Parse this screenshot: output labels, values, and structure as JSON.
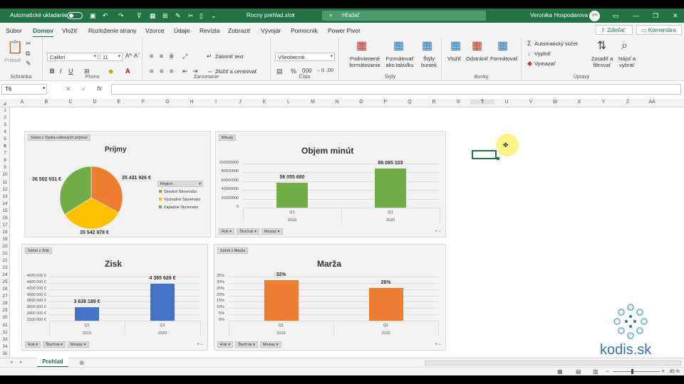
{
  "titlebar": {
    "autosave_label": "Automatické ukladanie",
    "filename": "Rocny prehlad.xlsx",
    "search_placeholder": "Hľadať",
    "user_name": "Veronika Hospodarova",
    "user_initials": "VH"
  },
  "tabs": [
    "Súbor",
    "Domov",
    "Vložiť",
    "Rozloženie strany",
    "Vzorce",
    "Údaje",
    "Revízia",
    "Zobraziť",
    "Vývojár",
    "Pomocník",
    "Power Pivot"
  ],
  "active_tab": "Domov",
  "share_label": "Zdieľať",
  "comments_label": "Komentáre",
  "ribbon": {
    "clipboard": {
      "paste": "Prilepiť",
      "group": "Schránka"
    },
    "font": {
      "name": "Calibri",
      "size": "11",
      "group": "Písmo"
    },
    "alignment": {
      "wrap": "Zalomiť text",
      "merge": "Zlúčiť a centrovať",
      "group": "Zarovnanie"
    },
    "number": {
      "format": "Všeobecné",
      "group": "Číslo"
    },
    "styles": {
      "conditional": [
        "Podmienené",
        "formátovanie"
      ],
      "table": [
        "Formátovať",
        "ako tabuľku"
      ],
      "cell": [
        "Štýly",
        "buniek"
      ],
      "group": "Štýly"
    },
    "cells": {
      "insert": "Vložiť",
      "delete": "Odstrániť",
      "format": "Formátovať",
      "group": "Bunky"
    },
    "editing": {
      "autosum": "Automatický súčet",
      "fill": "Vyplniť",
      "clear": "Vymazať",
      "sort": [
        "Zoradiť a",
        "filtrovať"
      ],
      "find": [
        "Nájsť a",
        "vybrať"
      ],
      "group": "Úpravy"
    }
  },
  "formula_bar": {
    "name_box": "T6",
    "fx": "fx",
    "formula": ""
  },
  "columns": [
    "A",
    "B",
    "C",
    "D",
    "E",
    "F",
    "G",
    "H",
    "I",
    "J",
    "K",
    "L",
    "M",
    "N",
    "O",
    "P",
    "Q",
    "R",
    "S",
    "T",
    "U",
    "V",
    "W",
    "X",
    "Y",
    "Z",
    "AA"
  ],
  "selected_column": "T",
  "rows": [
    "1",
    "2",
    "3",
    "4",
    "5",
    "6",
    "7",
    "8",
    "9",
    "10",
    "11",
    "12",
    "13",
    "14",
    "15",
    "16",
    "17",
    "18",
    "19",
    "20",
    "21",
    "22",
    "23",
    "24",
    "25",
    "26",
    "27",
    "28",
    "29",
    "30",
    "31",
    "32",
    "33",
    "34",
    "35"
  ],
  "selected_row": "6",
  "sheet_tab": "Prehlad",
  "zoom": "85 %",
  "brand": "kodis.sk",
  "chart_data": [
    {
      "type": "pie",
      "label": "Súčet z Vyska celkových príjmov",
      "title": "Príjmy",
      "legend_title": "Region",
      "slices": [
        {
          "name": "Stredné Slovensko",
          "value_label": "35 431 926 €",
          "value": 35431926,
          "color": "#ed7d31"
        },
        {
          "name": "Východné Slovensko",
          "value_label": "35 542 978 €",
          "value": 35542978,
          "color": "#ffc000"
        },
        {
          "name": "Západné Slovensko",
          "value_label": "36 502 031 €",
          "value": 36502031,
          "color": "#70ad47"
        }
      ]
    },
    {
      "type": "bar",
      "label": "Minuty",
      "title": "Objem minút",
      "color": "#70ad47",
      "yticks": [
        "100000000",
        "80000000",
        "60000000",
        "40000000",
        "20000000",
        "0"
      ],
      "ylim": [
        0,
        100000000
      ],
      "categories": [
        {
          "q": "Q1",
          "year": "2019"
        },
        {
          "q": "Q1",
          "year": "2020"
        }
      ],
      "values": [
        56055680,
        88085103
      ],
      "value_labels": [
        "56 055 680",
        "88 085 103"
      ],
      "filters": [
        "Rok",
        "Štvrťrok",
        "Mesiac"
      ]
    },
    {
      "type": "bar",
      "label": "Súčet z Zisk",
      "title": "Zisk",
      "color": "#4472c4",
      "yticks": [
        "4600 000 €",
        "4400 000 €",
        "4200 000 €",
        "4000 000 €",
        "3800 000 €",
        "3600 000 €",
        "3400 000 €",
        "3200 000 €"
      ],
      "ylim": [
        3200000,
        4600000
      ],
      "categories": [
        {
          "q": "Q1",
          "year": "2019"
        },
        {
          "q": "Q1",
          "year": "2020"
        }
      ],
      "values": [
        3638189,
        4365628
      ],
      "value_labels": [
        "3 638 189 €",
        "4 365 628 €"
      ],
      "filters": [
        "Rok",
        "Štvrťrok",
        "Mesiac"
      ]
    },
    {
      "type": "bar",
      "label": "Súčet z Marža",
      "title": "Marža",
      "color": "#ed7d31",
      "yticks": [
        "35%",
        "30%",
        "25%",
        "20%",
        "15%",
        "10%",
        "5%",
        "0%"
      ],
      "ylim": [
        0,
        35
      ],
      "categories": [
        {
          "q": "Q1",
          "year": "2019"
        },
        {
          "q": "Q1",
          "year": "2020"
        }
      ],
      "values": [
        32,
        26
      ],
      "value_labels": [
        "32%",
        "26%"
      ],
      "filters": [
        "Rok",
        "Štvrťrok",
        "Mesiac"
      ]
    }
  ]
}
